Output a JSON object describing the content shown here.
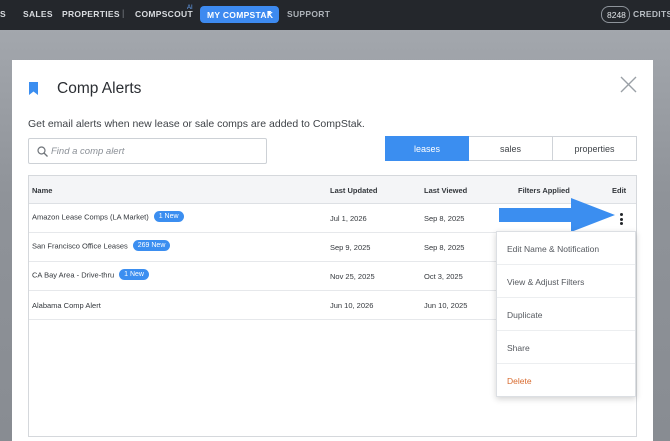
{
  "nav": {
    "items": [
      "S",
      "SALES",
      "PROPERTIES",
      "COMPSCOUT"
    ],
    "separator": "|",
    "compscout_sup": "AI",
    "my_compstak": "MY COMPSTAK",
    "support": "SUPPORT",
    "credits_count": "8248",
    "credits_label": "CREDITS"
  },
  "modal": {
    "title": "Comp Alerts",
    "subtitle": "Get email alerts when new lease or sale comps are added to CompStak.",
    "search_placeholder": "Find a comp alert",
    "segments": [
      "leases",
      "sales",
      "properties"
    ],
    "active_segment": "leases"
  },
  "table": {
    "headers": {
      "name": "Name",
      "last_updated": "Last Updated",
      "last_viewed": "Last Viewed",
      "filters_applied": "Filters Applied",
      "edit": "Edit"
    },
    "rows": [
      {
        "name": "Amazon Lease Comps (LA Market)",
        "badge": "1 New",
        "last_updated": "Jul 1, 2026",
        "last_viewed": "Sep 8, 2025"
      },
      {
        "name": "San Francisco Office Leases",
        "badge": "269 New",
        "last_updated": "Sep 9, 2025",
        "last_viewed": "Sep 8, 2025"
      },
      {
        "name": "CA Bay Area - Drive-thru",
        "badge": "1 New",
        "last_updated": "Nov 25, 2025",
        "last_viewed": "Oct 3, 2025"
      },
      {
        "name": "Alabama Comp Alert",
        "badge": "",
        "last_updated": "Jun 10, 2026",
        "last_viewed": "Jun 10, 2025"
      }
    ]
  },
  "menu": {
    "items": [
      "Edit Name & Notification",
      "View & Adjust Filters",
      "Duplicate",
      "Share",
      "Delete"
    ]
  },
  "colors": {
    "accent": "#3b8ef0",
    "danger": "#d86a2e",
    "nav_bg": "#24272c"
  },
  "icons": [
    "bookmark-icon",
    "close-icon",
    "search-icon",
    "kebab-menu-icon",
    "chevron-down-icon",
    "arrow-pointer-icon"
  ]
}
